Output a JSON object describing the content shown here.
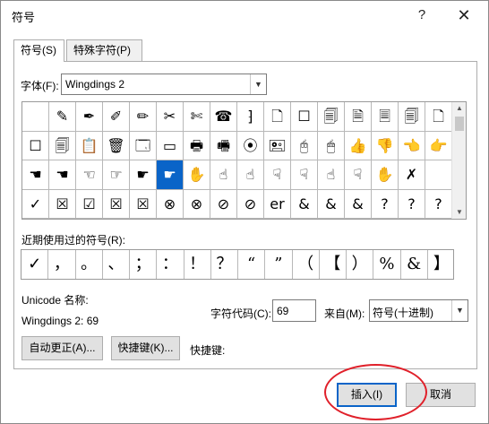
{
  "window": {
    "title": "符号",
    "help_glyph": "?",
    "close_glyph": "✕"
  },
  "tabs": [
    {
      "label": "符号(S)",
      "active": true
    },
    {
      "label": "特殊字符(P)",
      "active": false
    }
  ],
  "font": {
    "label": "字体(F):",
    "value": "Wingdings 2"
  },
  "symbol_grid": {
    "rows": [
      [
        "",
        "✎",
        "✒",
        "✐",
        "✏",
        "✂",
        "✄",
        "☎",
        "⁆",
        "🗋",
        "☐",
        "🗐",
        "🗎",
        "🗏",
        "🗐",
        "🗋"
      ],
      [
        "☐",
        "🗐",
        "📋",
        "🗑",
        "🗔",
        "▭",
        "🖶",
        "🖷",
        "⦿",
        "🖭",
        "🖰",
        "🖱",
        "👍",
        "👎",
        "👈",
        "👉"
      ],
      [
        "☚",
        "☚",
        "☜",
        "☞",
        "☛",
        "☛",
        "✋",
        "☝",
        "☝",
        "☟",
        "☟",
        "☝",
        "☟",
        "✋",
        "✗",
        ""
      ],
      [
        "✓",
        "☒",
        "☑",
        "☒",
        "☒",
        "⊗",
        "⊗",
        "⊘",
        "⊘",
        "er",
        "&",
        "&",
        "&",
        "?",
        "?",
        "?"
      ]
    ],
    "selected": {
      "row": 2,
      "col": 5
    },
    "scroll_up": "▲",
    "scroll_down": "▼"
  },
  "recent": {
    "label": "近期使用过的符号(R):",
    "symbols": [
      "✓",
      "，",
      "。",
      "、",
      "；",
      "：",
      "！",
      "？",
      "“",
      "”",
      "（",
      "【",
      "）",
      "%",
      "&",
      "】"
    ]
  },
  "unicode": {
    "label": "Unicode 名称:",
    "value": "Wingdings 2: 69"
  },
  "char_code": {
    "label": "字符代码(C):",
    "value": "69"
  },
  "from": {
    "label": "来自(M):",
    "value": "符号(十进制)"
  },
  "buttons": {
    "autocorrect": "自动更正(A)...",
    "shortcut_key": "快捷键(K)...",
    "shortcut_label": "快捷键:",
    "insert": "插入(I)",
    "cancel": "取消"
  },
  "accent_color": "#0a64c8",
  "annotation_color": "#e0202a"
}
